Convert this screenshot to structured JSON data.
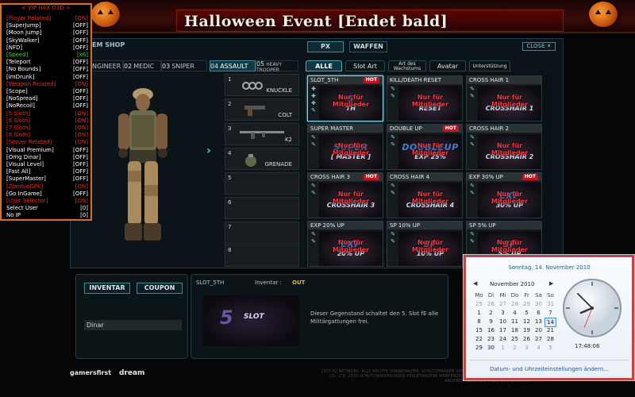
{
  "banner": {
    "title": "Halloween Event [Endet bald]"
  },
  "shop": {
    "title": "EM SHOP",
    "tabs": {
      "px": "PX",
      "waffen": "WAFFEN"
    },
    "close": "CLOSE ✕",
    "classes": [
      {
        "num": "",
        "label": "ENGINEER"
      },
      {
        "num": "02",
        "label": "MEDIC"
      },
      {
        "num": "03",
        "label": "SNIPER"
      },
      {
        "num": "04",
        "label": "ASSAULT"
      },
      {
        "num": "05",
        "label": "HEAVY TROOPER"
      }
    ],
    "slots": [
      {
        "n": "1",
        "label": "KNUCKLE"
      },
      {
        "n": "2",
        "label": "COLT"
      },
      {
        "n": "3",
        "label": "K2"
      },
      {
        "n": "4",
        "label": "GRENADE"
      },
      {
        "n": "5",
        "label": ""
      },
      {
        "n": "6",
        "label": ""
      },
      {
        "n": "7",
        "label": ""
      },
      {
        "n": "8",
        "label": ""
      }
    ],
    "categories": [
      "ALLE",
      "Slot Art",
      "Art des Wachstums",
      "Avatar",
      "Unterstützung"
    ],
    "items": [
      {
        "name": "SLOT_5TH",
        "hot": "HOT",
        "big": "5",
        "sub": "TH",
        "overlay": "Nur für Mitglieder"
      },
      {
        "name": "KILL/DEATH RESET",
        "hot": "",
        "big": "",
        "sub": "RESET",
        "overlay": "Nur für Mitglieder"
      },
      {
        "name": "CROSS HAIR 1",
        "hot": "",
        "big": "",
        "sub": "CROSSHAIR 1",
        "overlay": "Nur für Mitglieder"
      },
      {
        "name": "SUPER MASTER",
        "hot": "",
        "big": "SUPER",
        "sub": "[ MASTER ]",
        "overlay": "Nur für Mitglieder"
      },
      {
        "name": "DOUBLE UP",
        "hot": "HOT",
        "big": "DOUBLEUP",
        "sub": "EXP 25%",
        "overlay": "Nur für Mitglieder"
      },
      {
        "name": "CROSS HAIR 2",
        "hot": "",
        "big": "",
        "sub": "CROSSHAIR 2",
        "overlay": "Nur für Mitglieder"
      },
      {
        "name": "CROSS HAIR 3",
        "hot": "HOT",
        "big": "",
        "sub": "CROSSHAIR 3",
        "overlay": "Nur für Mitglieder"
      },
      {
        "name": "CROSS HAIR 4",
        "hot": "",
        "big": "",
        "sub": "CROSSHAIR 4",
        "overlay": "Nur für Mitglieder"
      },
      {
        "name": "EXP 30% UP",
        "hot": "HOT",
        "big": "EXP",
        "sub": "30% UP",
        "overlay": "Nur für Mitglieder"
      },
      {
        "name": "EXP 20% UP",
        "hot": "",
        "big": "EXP",
        "sub": "20% UP",
        "overlay": "Nur für Mitglieder"
      },
      {
        "name": "SP 10% UP",
        "hot": "",
        "big": "SP",
        "sub": "10% UP",
        "overlay": "Nur für Mitglieder"
      },
      {
        "name": "SP 5% UP",
        "hot": "",
        "big": "SP",
        "sub": "5% UP",
        "overlay": "Nur für Mitglieder"
      }
    ],
    "bottom": {
      "inventar": "INVENTAR",
      "coupon": "COUPON",
      "dinar": "Dinar",
      "slotname": "SLOT_5TH",
      "inventar_label": "Inventar :",
      "inventar_value": "OUT",
      "item_big": "5",
      "item_sub": "SLOT",
      "desc": "Dieser Gegenstand schaltet den 5. Slot fE alle Militärgattungen frei."
    },
    "footer": {
      "logo1": "gamersfirst",
      "logo2": "dream",
      "copy": "2007 K2 NETWORK. ALLE RECHTE VORBEHALTEN. SCHUTZMARKEN VON DREAMEXECUTION TECHNOLOGY CO., LTD. 2010 SCHUTZMARKEN ODER EINGETRAGENE MARKENZEICHEN VON K2 NETWORK INC. ALLE ANDEREN SCHUTZMARKEN SIND EIGENTUM"
    }
  },
  "hack": {
    "header": "< VIP HAX D3D >",
    "colors": {
      "red": "#e63020",
      "white": "#ffffff",
      "green": "#3bd33b"
    },
    "rows": [
      {
        "k": "[Player Related]",
        "v": "[ON]",
        "c": "red"
      },
      {
        "k": "[SuperJump]",
        "v": "[OFF]",
        "c": "white"
      },
      {
        "k": "[Moon Jump]",
        "v": "[OFF]",
        "c": "white"
      },
      {
        "k": "[SkyWalker]",
        "v": "[OFF]",
        "c": "white"
      },
      {
        "k": "[NFD]",
        "v": "[OFF]",
        "c": "white"
      },
      {
        "k": "[Speed]",
        "v": "[x6]",
        "c": "green"
      },
      {
        "k": "[Teleport",
        "v": "[OFF]",
        "c": "white"
      },
      {
        "k": "[No Bounds]",
        "v": "[OFF]",
        "c": "white"
      },
      {
        "k": "[ImDrunk]",
        "v": "[OFF]",
        "c": "white"
      },
      {
        "k": "[Weapon Related]",
        "v": "[ON]",
        "c": "red"
      },
      {
        "k": "[Scope]",
        "v": "[OFF]",
        "c": "white"
      },
      {
        "k": "[NoSpread]",
        "v": "[OFF]",
        "c": "white"
      },
      {
        "k": "[NoRecoil]",
        "v": "[OFF]",
        "c": "white"
      },
      {
        "k": "[5 Sloth]",
        "v": "[ON]",
        "c": "red"
      },
      {
        "k": "[6 Sloth]",
        "v": "[ON]",
        "c": "red"
      },
      {
        "k": "[7 Sloth]",
        "v": "[ON]",
        "c": "red"
      },
      {
        "k": "[8 Sloth]",
        "v": "[ON]",
        "c": "red"
      },
      {
        "k": "[Server Related]",
        "v": "[ON]",
        "c": "red"
      },
      {
        "k": "[Visual Premium]",
        "v": "[OFF]",
        "c": "white"
      },
      {
        "k": "[Omg Dinar]",
        "v": "[OFF]",
        "c": "white"
      },
      {
        "k": "[Visual Level]",
        "v": "[OFF]",
        "c": "white"
      },
      {
        "k": "[Fast All]",
        "v": "[OFF]",
        "c": "white"
      },
      {
        "k": "[SuperMaster]",
        "v": "[OFF]",
        "c": "white"
      },
      {
        "k": "[ZombieOPK]",
        "v": "[ON]",
        "c": "red"
      },
      {
        "k": "[Go InGame]",
        "v": "[OFF]",
        "c": "white"
      },
      {
        "k": "[User Selector]",
        "v": "[ON]",
        "c": "red"
      },
      {
        "k": "Select User",
        "v": "[0]",
        "c": "white"
      },
      {
        "k": "No IP",
        "v": "[0]",
        "c": "white"
      }
    ]
  },
  "calendar": {
    "full_date": "Sonntag, 14. November 2010",
    "month": "November 2010",
    "prev": "◀",
    "next": "▶",
    "weekdays": [
      "Mo",
      "Di",
      "Mi",
      "Do",
      "Fr",
      "Sa",
      "So"
    ],
    "weeks": [
      [
        "25",
        "26",
        "27",
        "28",
        "29",
        "30",
        "31"
      ],
      [
        "1",
        "2",
        "3",
        "4",
        "5",
        "6",
        "7"
      ],
      [
        "8",
        "9",
        "10",
        "11",
        "12",
        "13",
        "14"
      ],
      [
        "15",
        "16",
        "17",
        "18",
        "19",
        "20",
        "21"
      ],
      [
        "22",
        "23",
        "24",
        "25",
        "26",
        "27",
        "28"
      ],
      [
        "29",
        "30",
        "1",
        "2",
        "3",
        "4",
        "5"
      ]
    ],
    "time": "17:48:06",
    "link": "Datum- und Uhrzeiteinstellungen ändern..."
  }
}
